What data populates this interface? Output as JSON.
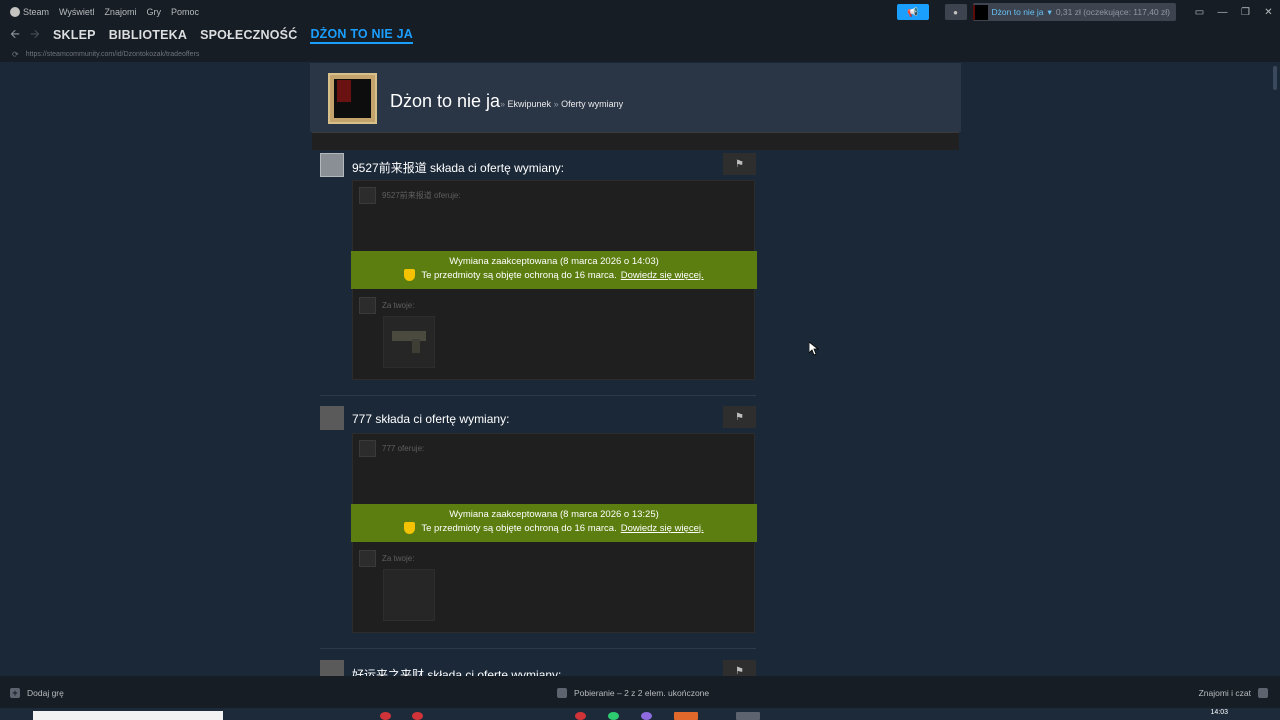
{
  "menubar": {
    "app": "Steam",
    "items": [
      "Wyświetl",
      "Znajomi",
      "Gry",
      "Pomoc"
    ],
    "account_name": "Dżon to nie ja",
    "account_balance": "0,31 zł (oczekujące: 117,40 zł)"
  },
  "nav": {
    "links": [
      "SKLEP",
      "BIBLIOTEKA",
      "SPOŁECZNOŚĆ",
      "DŻON TO NIE JA"
    ],
    "active": "DŻON TO NIE JA",
    "url": "https://steamcommunity.com/id/Dzontokozak/tradeoffers"
  },
  "profile": {
    "name": "Dżon to nie ja",
    "breadcrumb_sep": "»",
    "crumb1": "Ekwipunek",
    "crumb2": "Oferty wymiany"
  },
  "offers": [
    {
      "title": "9527前来报道 składa ci ofertę wymiany:",
      "offers_label": "9527前来报道 oferuje:",
      "status": "Wymiana zaakceptowana (8 marca 2026 o 14:03)",
      "protection": "Te przedmioty są objęte ochroną do 16 marca.",
      "learn_more": "Dowiedz się więcej.",
      "yours_label": "Za twoje:"
    },
    {
      "title": "777 składa ci ofertę wymiany:",
      "offers_label": "777 oferuje:",
      "status": "Wymiana zaakceptowana (8 marca 2026 o 13:25)",
      "protection": "Te przedmioty są objęte ochroną do 16 marca.",
      "learn_more": "Dowiedz się więcej.",
      "yours_label": "Za twoje:"
    },
    {
      "title": "好运来之来财 składa ci ofertę wymiany:"
    }
  ],
  "footer": {
    "add_game": "Dodaj grę",
    "downloads": "Pobieranie – 2 z 2 elem. ukończone",
    "friends": "Znajomi i czat"
  },
  "taskbar": {
    "clock": "14:03"
  },
  "colors": {
    "accent": "#1a9fff",
    "accepted_banner": "#5c7e10",
    "page_bg": "#1b2838"
  }
}
